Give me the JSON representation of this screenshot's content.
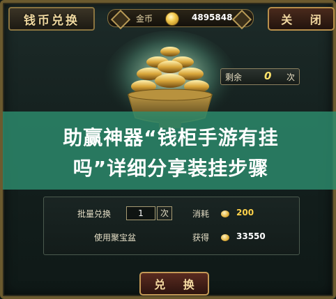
{
  "header": {
    "title": "钱币兑换",
    "coin_label": "金币",
    "coin_balance": "4895848",
    "close_label": "关 闭"
  },
  "treasure": {
    "remaining_label": "剩余",
    "remaining_count": "0",
    "remaining_unit": "次"
  },
  "banner": {
    "line1": "助赢神器“钱柜手游有挂",
    "line2": "吗”详细分享装挂步骤"
  },
  "panel": {
    "batch_label": "批量兑换",
    "batch_value": "1",
    "batch_unit": "次",
    "cost_label": "消耗",
    "cost_value": "200",
    "use_box_label": "使用聚宝盆",
    "gain_label": "获得",
    "gain_value": "33550"
  },
  "actions": {
    "exchange_label": "兑 换"
  },
  "colors": {
    "gold": "#f2c94c",
    "banner": "#2d8c6e",
    "value_yellow": "#ffd24a"
  }
}
